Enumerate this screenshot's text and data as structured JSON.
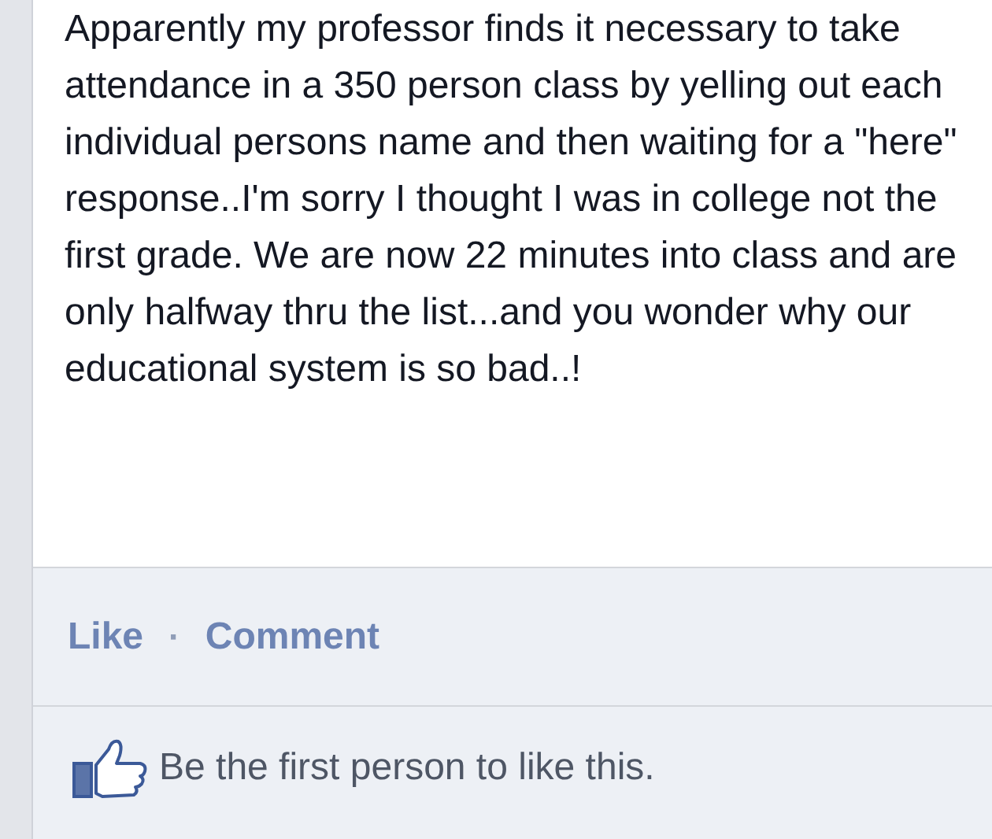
{
  "post": {
    "text": "Apparently my professor finds it necessary to take attendance in a 350 person class by yelling out each individual persons name and then waiting for a \"here\" response..I'm sorry I thought I was in college not the first grade. We are now 22 minutes into class and are only halfway thru the list...and you wonder why our educational system is so bad..!"
  },
  "actions": [
    {
      "label": "Like"
    },
    {
      "label": "·",
      "kind": "separator"
    },
    {
      "label": "Comment"
    }
  ],
  "likes": {
    "text": "Be the first person to like this."
  }
}
